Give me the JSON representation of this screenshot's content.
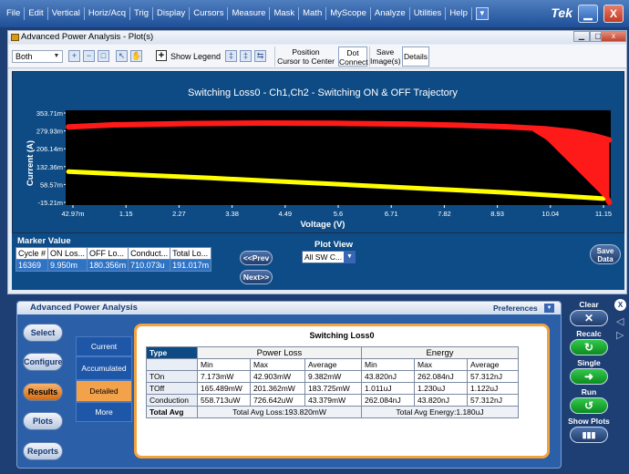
{
  "menubar": {
    "items": [
      "File",
      "Edit",
      "Vertical",
      "Horiz/Acq",
      "Trig",
      "Display",
      "Cursors",
      "Measure",
      "Mask",
      "Math",
      "MyScope",
      "Analyze",
      "Utilities",
      "Help"
    ],
    "brand": "Tek"
  },
  "plot_window": {
    "title": "Advanced Power Analysis - Plot(s)",
    "toolbar": {
      "view_select": "Both",
      "show_legend": "Show Legend",
      "position_cursor_line1": "Position",
      "position_cursor_line2": "Cursor to Center",
      "dot_connect_line1": "Dot",
      "dot_connect_line2": "Connect",
      "save_image_line1": "Save",
      "save_image_line2": "Image(s)",
      "details": "Details"
    }
  },
  "chart_data": {
    "type": "line",
    "title": "Switching Loss0 - Ch1,Ch2 - Switching ON & OFF Trajectory",
    "xlabel": "Voltage (V)",
    "ylabel": "Current (A)",
    "x_ticks": [
      "42.97m",
      "1.15",
      "2.27",
      "3.38",
      "4.49",
      "5.6",
      "6.71",
      "7.82",
      "8.93",
      "10.04",
      "11.15"
    ],
    "y_ticks": [
      "353.71m",
      "279.93m",
      "206.14m",
      "132.36m",
      "58.57m",
      "-15.21m"
    ],
    "xlim": [
      0.04297,
      11.15
    ],
    "ylim": [
      -0.01521,
      0.35371
    ],
    "series": [
      {
        "color": "#ff1a1a",
        "x": [
          0.1,
          1.0,
          2.5,
          4.0,
          5.5,
          7.0,
          8.2,
          9.0,
          9.8,
          10.4,
          10.8,
          11.0,
          11.12
        ],
        "y": [
          0.289,
          0.297,
          0.302,
          0.304,
          0.303,
          0.3,
          0.295,
          0.29,
          0.282,
          0.27,
          0.255,
          0.245,
          0.238
        ]
      },
      {
        "color": "#ff1a1a",
        "x": [
          9.6,
          10.1,
          10.5,
          10.85,
          11.05,
          11.12
        ],
        "y": [
          0.28,
          0.22,
          0.14,
          0.07,
          0.02,
          -0.005
        ]
      },
      {
        "color": "#ffff00",
        "x": [
          0.1,
          1.5,
          3.0,
          4.5,
          6.0,
          7.5,
          9.0,
          10.2,
          11.0
        ],
        "y": [
          0.115,
          0.103,
          0.09,
          0.076,
          0.062,
          0.048,
          0.034,
          0.02,
          0.01
        ]
      }
    ]
  },
  "marker": {
    "label": "Marker Value",
    "headers": [
      "Cycle #",
      "ON Los...",
      "OFF Lo...",
      "Conduct...",
      "Total Lo..."
    ],
    "values": [
      "16369",
      "9.950m",
      "180.356m",
      "710.073u",
      "191.017m"
    ],
    "prev": "<<Prev",
    "next": "Next>>",
    "plot_view_label": "Plot View",
    "plot_view_value": "All SW C...",
    "save_data_line1": "Save",
    "save_data_line2": "Data"
  },
  "bottom": {
    "title": "Advanced Power Analysis",
    "preferences": "Preferences",
    "side_buttons": [
      "Select",
      "Configure",
      "Results",
      "Plots",
      "Reports"
    ],
    "sub_tabs": [
      "Current",
      "Accumulated",
      "Detailed",
      "More"
    ],
    "results_title": "Switching Loss0",
    "table": {
      "type_header": "Type",
      "power_loss": "Power Loss",
      "energy": "Energy",
      "sub": [
        "Min",
        "Max",
        "Average",
        "Min",
        "Max",
        "Average"
      ],
      "rows": [
        {
          "name": "TOn",
          "vals": [
            "7.173mW",
            "42.903mW",
            "9.382mW",
            "43.820nJ",
            "262.084nJ",
            "57.312nJ"
          ]
        },
        {
          "name": "TOff",
          "vals": [
            "165.489mW",
            "201.362mW",
            "183.725mW",
            "1.011uJ",
            "1.230uJ",
            "1.122uJ"
          ]
        },
        {
          "name": "Conduction",
          "vals": [
            "558.713uW",
            "726.642uW",
            "43.379mW",
            "262.084nJ",
            "43.820nJ",
            "57.312nJ"
          ]
        }
      ],
      "total_label": "Total Avg",
      "total_loss": "Total Avg Loss:193.820mW",
      "total_energy": "Total Avg Energy:1.180uJ"
    }
  },
  "right_controls": {
    "clear": "Clear",
    "recalc": "Recalc",
    "single": "Single",
    "run": "Run",
    "show_plots": "Show Plots"
  }
}
